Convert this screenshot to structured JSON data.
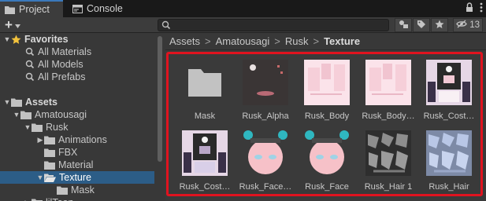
{
  "tabs": [
    {
      "label": "Project",
      "icon": "folder-icon"
    },
    {
      "label": "Console",
      "icon": "console-icon"
    }
  ],
  "toolbar": {
    "add_label": "+",
    "search_value": "",
    "hidden_count": "13"
  },
  "tree": [
    {
      "label": "Favorites",
      "icon": "star-icon",
      "expanded": true,
      "bold": true
    },
    {
      "label": "All Materials",
      "icon": "search-icon"
    },
    {
      "label": "All Models",
      "icon": "search-icon"
    },
    {
      "label": "All Prefabs",
      "icon": "search-icon"
    },
    {
      "label": "Assets",
      "icon": "folder-icon",
      "expanded": true,
      "bold": true
    },
    {
      "label": "Amatousagi",
      "icon": "folder-icon",
      "expanded": true
    },
    {
      "label": "Rusk",
      "icon": "folder-icon",
      "expanded": true
    },
    {
      "label": "Animations",
      "icon": "folder-icon",
      "collapsed": true
    },
    {
      "label": "FBX",
      "icon": "folder-icon"
    },
    {
      "label": "Material",
      "icon": "folder-icon"
    },
    {
      "label": "Texture",
      "icon": "folder-open-icon",
      "expanded": true,
      "selected": true
    },
    {
      "label": "Mask",
      "icon": "folder-icon"
    },
    {
      "label": "lilToon",
      "icon": "folder-icon",
      "collapsed": true
    }
  ],
  "breadcrumb": [
    "Assets",
    "Amatousagi",
    "Rusk",
    "Texture"
  ],
  "assets": [
    {
      "label": "Mask",
      "kind": "folder"
    },
    {
      "label": "Rusk_Alpha",
      "kind": "alpha"
    },
    {
      "label": "Rusk_Body",
      "kind": "body"
    },
    {
      "label": "Rusk_Body…",
      "kind": "body"
    },
    {
      "label": "Rusk_Cost…",
      "kind": "costume"
    },
    {
      "label": "Rusk_Cost…",
      "kind": "costume"
    },
    {
      "label": "Rusk_Face…",
      "kind": "face"
    },
    {
      "label": "Rusk_Face",
      "kind": "face"
    },
    {
      "label": "Rusk_Hair 1",
      "kind": "hair-dark"
    },
    {
      "label": "Rusk_Hair",
      "kind": "hair-blue"
    }
  ],
  "colors": {
    "selection": "#2c5d87",
    "highlight_border": "#e0131f",
    "tab_accent": "#3a79bb"
  }
}
